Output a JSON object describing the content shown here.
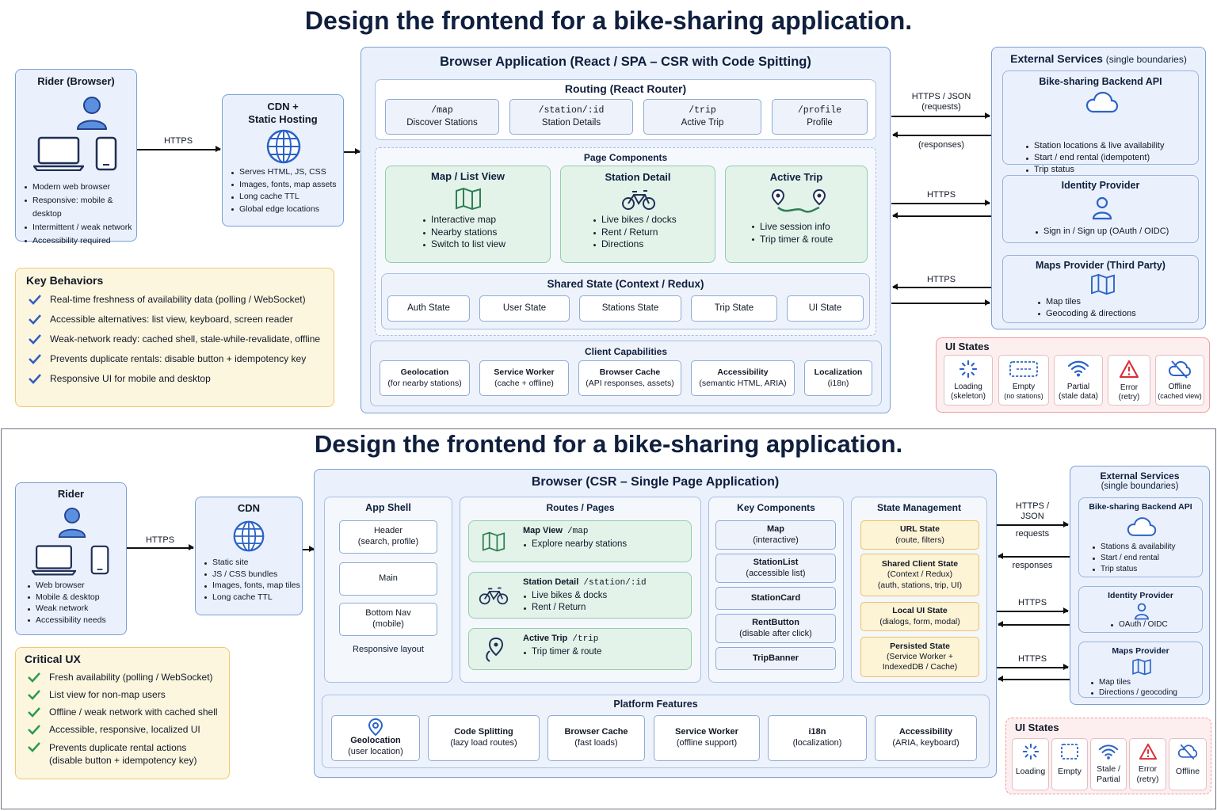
{
  "top": {
    "title": "Design the frontend for a bike-sharing application.",
    "rider": {
      "title": "Rider (Browser)",
      "items": [
        "Modern web browser",
        "Responsive: mobile & desktop",
        "Intermittent / weak network",
        "Accessibility required"
      ]
    },
    "https_label": "HTTPS",
    "cdn": {
      "title_1": "CDN +",
      "title_2": "Static Hosting",
      "items": [
        "Serves HTML, JS, CSS",
        "Images, fonts, map assets",
        "Long cache TTL",
        "Global edge locations"
      ]
    },
    "app": {
      "title": "Browser Application (React / SPA – CSR with Code Spitting)",
      "routing": {
        "title": "Routing (React Router)",
        "routes": [
          {
            "path": "/map",
            "name": "Discover Stations"
          },
          {
            "path": "/station/:id",
            "name": "Station Details"
          },
          {
            "path": "/trip",
            "name": "Active Trip"
          },
          {
            "path": "/profile",
            "name": "Profile"
          }
        ]
      },
      "page_components": {
        "title": "Page Components",
        "map": {
          "title": "Map / List View",
          "items": [
            "Interactive map",
            "Nearby stations",
            "Switch to list view"
          ]
        },
        "station": {
          "title": "Station Detail",
          "items": [
            "Live bikes / docks",
            "Rent / Return",
            "Directions"
          ]
        },
        "trip": {
          "title": "Active Trip",
          "items": [
            "Live session info",
            "Trip timer & route"
          ]
        }
      },
      "shared_state": {
        "title": "Shared State (Context / Redux)",
        "items": [
          "Auth State",
          "User State",
          "Stations State",
          "Trip State",
          "UI State"
        ]
      },
      "capabilities": {
        "title": "Client Capabilities",
        "items": [
          {
            "name": "Geolocation",
            "sub": "(for nearby stations)"
          },
          {
            "name": "Service Worker",
            "sub": "(cache + offline)"
          },
          {
            "name": "Browser Cache",
            "sub": "(API responses, assets)"
          },
          {
            "name": "Accessibility",
            "sub": "(semantic HTML, ARIA)"
          },
          {
            "name": "Localization",
            "sub": "(i18n)"
          }
        ]
      }
    },
    "conn": {
      "req_1": "HTTPS / JSON",
      "req_2": "(requests)",
      "resp": "(responses)",
      "https_idp": "HTTPS",
      "https_maps": "HTTPS"
    },
    "external": {
      "title": "External Services",
      "subtitle": "(single boundaries)",
      "backend": {
        "title": "Bike-sharing Backend API",
        "items": [
          "Station locations & live availability",
          "Start / end rental (idempotent)",
          "Trip status"
        ]
      },
      "idp": {
        "title": "Identity Provider",
        "items": [
          "Sign in / Sign up (OAuth / OIDC)"
        ]
      },
      "maps": {
        "title": "Maps Provider (Third Party)",
        "items": [
          "Map tiles",
          "Geocoding & directions"
        ]
      }
    },
    "ui_states": {
      "title": "UI States",
      "items": [
        {
          "name": "Loading",
          "sub": "(skeleton)"
        },
        {
          "name": "Empty",
          "sub": "(no stations)"
        },
        {
          "name": "Partial",
          "sub": "(stale data)"
        },
        {
          "name": "Error",
          "sub": "(retry)"
        },
        {
          "name": "Offline",
          "sub": "(cached view)"
        }
      ]
    },
    "key_behaviors": {
      "title": "Key Behaviors",
      "items": [
        "Real-time freshness of availability data (polling / WebSocket)",
        "Accessible alternatives: list view, keyboard, screen reader",
        "Weak-network ready: cached shell, stale-while-revalidate, offline",
        "Prevents duplicate rentals: disable button + idempotency key",
        "Responsive UI for mobile and desktop"
      ]
    }
  },
  "bottom": {
    "title": "Design the frontend for a bike-sharing application.",
    "rider": {
      "title": "Rider",
      "items": [
        "Web browser",
        "Mobile & desktop",
        "Weak network",
        "Accessibility needs"
      ]
    },
    "https_label": "HTTPS",
    "cdn": {
      "title": "CDN",
      "items": [
        "Static site",
        "JS / CSS bundles",
        "Images, fonts, map tiles",
        "Long cache TTL"
      ]
    },
    "browser": {
      "title": "Browser (CSR – Single Page Application)",
      "app_shell": {
        "title": "App Shell",
        "header": "Header",
        "header_sub": "(search, profile)",
        "main": "Main",
        "bottom_nav": "Bottom Nav",
        "bottom_nav_sub": "(mobile)",
        "note": "Responsive layout"
      },
      "routes": {
        "title": "Routes / Pages",
        "items": [
          {
            "name": "Map View",
            "path": "/map",
            "bullets": [
              "Explore nearby stations"
            ]
          },
          {
            "name": "Station Detail",
            "path": "/station/:id",
            "bullets": [
              "Live bikes & docks",
              "Rent / Return"
            ]
          },
          {
            "name": "Active Trip",
            "path": "/trip",
            "bullets": [
              "Trip timer & route"
            ]
          }
        ]
      },
      "key_components": {
        "title": "Key Components",
        "items": [
          {
            "name": "Map",
            "sub": "(interactive)"
          },
          {
            "name": "StationList",
            "sub": "(accessible list)"
          },
          {
            "name": "StationCard",
            "sub": ""
          },
          {
            "name": "RentButton",
            "sub": "(disable after click)"
          },
          {
            "name": "TripBanner",
            "sub": ""
          }
        ]
      },
      "state_mgmt": {
        "title": "State Management",
        "items": [
          {
            "name": "URL State",
            "sub": [
              "(route, filters)"
            ]
          },
          {
            "name": "Shared Client State",
            "sub": [
              "(Context / Redux)",
              "(auth, stations, trip, UI)"
            ]
          },
          {
            "name": "Local UI State",
            "sub": [
              "(dialogs, form, modal)"
            ]
          },
          {
            "name": "Persisted State",
            "sub": [
              "(Service Worker +",
              "IndexedDB / Cache)"
            ]
          }
        ]
      },
      "platform": {
        "title": "Platform Features",
        "items": [
          {
            "name": "Geolocation",
            "sub": "(user location)"
          },
          {
            "name": "Code Splitting",
            "sub": "(lazy load routes)"
          },
          {
            "name": "Browser Cache",
            "sub": "(fast loads)"
          },
          {
            "name": "Service Worker",
            "sub": "(offline support)"
          },
          {
            "name": "i18n",
            "sub": "(localization)"
          },
          {
            "name": "Accessibility",
            "sub": "(ARIA, keyboard)"
          }
        ]
      }
    },
    "conn": {
      "api_1": "HTTPS /",
      "api_2": "JSON",
      "requests": "requests",
      "responses": "responses",
      "https_idp": "HTTPS",
      "https_maps": "HTTPS"
    },
    "external": {
      "title": "External Services",
      "subtitle": "(single boundaries)",
      "backend": {
        "title": "Bike-sharing Backend API",
        "items": [
          "Stations & availability",
          "Start / end rental",
          "Trip status"
        ]
      },
      "idp": {
        "title": "Identity Provider",
        "items": [
          "OAuth / OIDC"
        ]
      },
      "maps": {
        "title": "Maps Provider",
        "items": [
          "Map tiles",
          "Directions / geocoding"
        ]
      }
    },
    "ui_states": {
      "title": "UI States",
      "items": [
        {
          "name": "Loading",
          "sub": ""
        },
        {
          "name": "Empty",
          "sub": ""
        },
        {
          "name": "Stale /",
          "sub": "Partial"
        },
        {
          "name": "Error",
          "sub": "(retry)"
        },
        {
          "name": "Offline",
          "sub": ""
        }
      ]
    },
    "critical_ux": {
      "title": "Critical UX",
      "items": [
        "Fresh availability (polling / WebSocket)",
        "List view for non-map users",
        "Offline / weak network with cached shell",
        "Accessible, responsive, localized UI",
        "Prevents duplicate rental actions"
      ],
      "last_item_sub": "(disable button + idempotency key)"
    }
  }
}
